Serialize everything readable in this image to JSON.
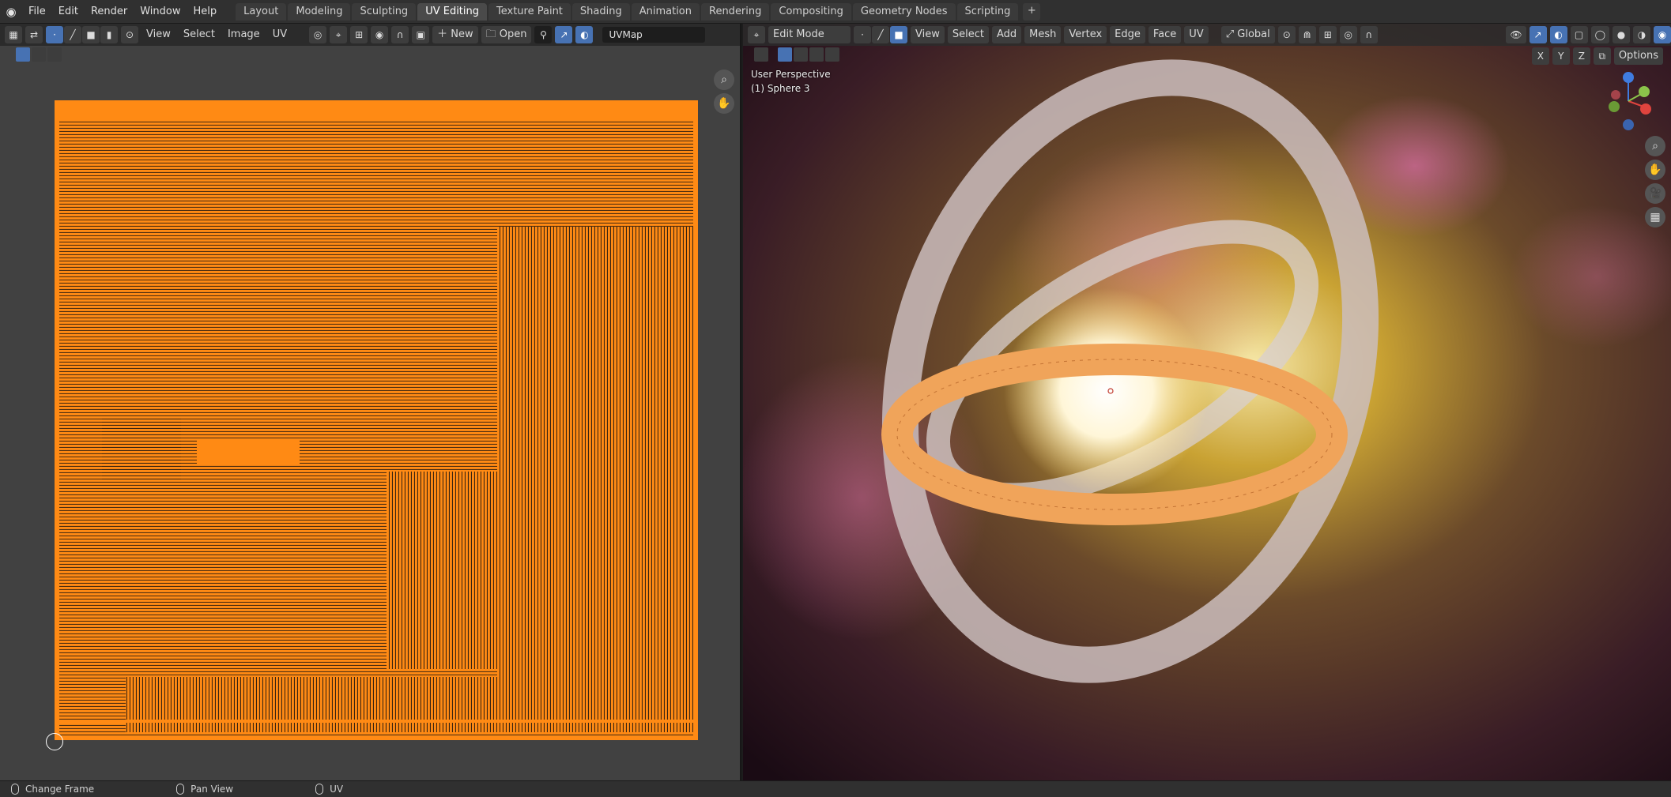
{
  "topbar": {
    "menus": [
      "File",
      "Edit",
      "Render",
      "Window",
      "Help"
    ],
    "tabs": [
      "Layout",
      "Modeling",
      "Sculpting",
      "UV Editing",
      "Texture Paint",
      "Shading",
      "Animation",
      "Rendering",
      "Compositing",
      "Geometry Nodes",
      "Scripting"
    ],
    "active_tab": "UV Editing",
    "add_tab": "+"
  },
  "uv_editor": {
    "menus": [
      "View",
      "Select",
      "Image",
      "UV"
    ],
    "new_label": "New",
    "open_label": "Open",
    "uvmap_name": "UVMap"
  },
  "viewport": {
    "mode": "Edit Mode",
    "menus": [
      "View",
      "Select",
      "Add",
      "Mesh",
      "Vertex",
      "Edge",
      "Face",
      "UV"
    ],
    "orientation": "Global",
    "axis_x": "X",
    "axis_y": "Y",
    "axis_z": "Z",
    "options_label": "Options",
    "perspective_text": "User Perspective",
    "object_text": "(1) Sphere 3"
  },
  "statusbar": {
    "items": [
      "Change Frame",
      "Pan View",
      "UV"
    ]
  },
  "colors": {
    "uv_wire": "#ff8a14",
    "active_tab": "#4a4a4a",
    "accent_blue": "#4772b3"
  }
}
